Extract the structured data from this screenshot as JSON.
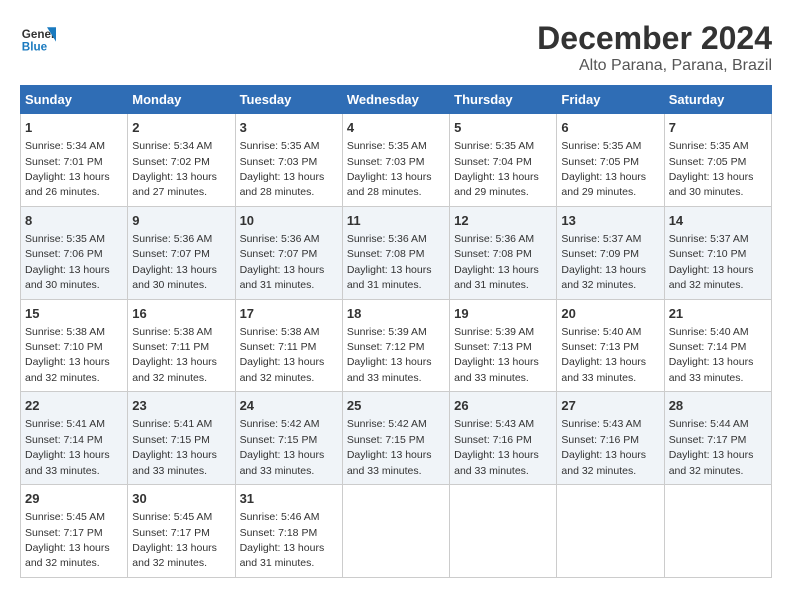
{
  "logo": {
    "general": "General",
    "blue": "Blue"
  },
  "title": "December 2024",
  "subtitle": "Alto Parana, Parana, Brazil",
  "days_header": [
    "Sunday",
    "Monday",
    "Tuesday",
    "Wednesday",
    "Thursday",
    "Friday",
    "Saturday"
  ],
  "weeks": [
    [
      {
        "day": "1",
        "info": "Sunrise: 5:34 AM\nSunset: 7:01 PM\nDaylight: 13 hours\nand 26 minutes."
      },
      {
        "day": "2",
        "info": "Sunrise: 5:34 AM\nSunset: 7:02 PM\nDaylight: 13 hours\nand 27 minutes."
      },
      {
        "day": "3",
        "info": "Sunrise: 5:35 AM\nSunset: 7:03 PM\nDaylight: 13 hours\nand 28 minutes."
      },
      {
        "day": "4",
        "info": "Sunrise: 5:35 AM\nSunset: 7:03 PM\nDaylight: 13 hours\nand 28 minutes."
      },
      {
        "day": "5",
        "info": "Sunrise: 5:35 AM\nSunset: 7:04 PM\nDaylight: 13 hours\nand 29 minutes."
      },
      {
        "day": "6",
        "info": "Sunrise: 5:35 AM\nSunset: 7:05 PM\nDaylight: 13 hours\nand 29 minutes."
      },
      {
        "day": "7",
        "info": "Sunrise: 5:35 AM\nSunset: 7:05 PM\nDaylight: 13 hours\nand 30 minutes."
      }
    ],
    [
      {
        "day": "8",
        "info": "Sunrise: 5:35 AM\nSunset: 7:06 PM\nDaylight: 13 hours\nand 30 minutes."
      },
      {
        "day": "9",
        "info": "Sunrise: 5:36 AM\nSunset: 7:07 PM\nDaylight: 13 hours\nand 30 minutes."
      },
      {
        "day": "10",
        "info": "Sunrise: 5:36 AM\nSunset: 7:07 PM\nDaylight: 13 hours\nand 31 minutes."
      },
      {
        "day": "11",
        "info": "Sunrise: 5:36 AM\nSunset: 7:08 PM\nDaylight: 13 hours\nand 31 minutes."
      },
      {
        "day": "12",
        "info": "Sunrise: 5:36 AM\nSunset: 7:08 PM\nDaylight: 13 hours\nand 31 minutes."
      },
      {
        "day": "13",
        "info": "Sunrise: 5:37 AM\nSunset: 7:09 PM\nDaylight: 13 hours\nand 32 minutes."
      },
      {
        "day": "14",
        "info": "Sunrise: 5:37 AM\nSunset: 7:10 PM\nDaylight: 13 hours\nand 32 minutes."
      }
    ],
    [
      {
        "day": "15",
        "info": "Sunrise: 5:38 AM\nSunset: 7:10 PM\nDaylight: 13 hours\nand 32 minutes."
      },
      {
        "day": "16",
        "info": "Sunrise: 5:38 AM\nSunset: 7:11 PM\nDaylight: 13 hours\nand 32 minutes."
      },
      {
        "day": "17",
        "info": "Sunrise: 5:38 AM\nSunset: 7:11 PM\nDaylight: 13 hours\nand 32 minutes."
      },
      {
        "day": "18",
        "info": "Sunrise: 5:39 AM\nSunset: 7:12 PM\nDaylight: 13 hours\nand 33 minutes."
      },
      {
        "day": "19",
        "info": "Sunrise: 5:39 AM\nSunset: 7:13 PM\nDaylight: 13 hours\nand 33 minutes."
      },
      {
        "day": "20",
        "info": "Sunrise: 5:40 AM\nSunset: 7:13 PM\nDaylight: 13 hours\nand 33 minutes."
      },
      {
        "day": "21",
        "info": "Sunrise: 5:40 AM\nSunset: 7:14 PM\nDaylight: 13 hours\nand 33 minutes."
      }
    ],
    [
      {
        "day": "22",
        "info": "Sunrise: 5:41 AM\nSunset: 7:14 PM\nDaylight: 13 hours\nand 33 minutes."
      },
      {
        "day": "23",
        "info": "Sunrise: 5:41 AM\nSunset: 7:15 PM\nDaylight: 13 hours\nand 33 minutes."
      },
      {
        "day": "24",
        "info": "Sunrise: 5:42 AM\nSunset: 7:15 PM\nDaylight: 13 hours\nand 33 minutes."
      },
      {
        "day": "25",
        "info": "Sunrise: 5:42 AM\nSunset: 7:15 PM\nDaylight: 13 hours\nand 33 minutes."
      },
      {
        "day": "26",
        "info": "Sunrise: 5:43 AM\nSunset: 7:16 PM\nDaylight: 13 hours\nand 33 minutes."
      },
      {
        "day": "27",
        "info": "Sunrise: 5:43 AM\nSunset: 7:16 PM\nDaylight: 13 hours\nand 32 minutes."
      },
      {
        "day": "28",
        "info": "Sunrise: 5:44 AM\nSunset: 7:17 PM\nDaylight: 13 hours\nand 32 minutes."
      }
    ],
    [
      {
        "day": "29",
        "info": "Sunrise: 5:45 AM\nSunset: 7:17 PM\nDaylight: 13 hours\nand 32 minutes."
      },
      {
        "day": "30",
        "info": "Sunrise: 5:45 AM\nSunset: 7:17 PM\nDaylight: 13 hours\nand 32 minutes."
      },
      {
        "day": "31",
        "info": "Sunrise: 5:46 AM\nSunset: 7:18 PM\nDaylight: 13 hours\nand 31 minutes."
      },
      null,
      null,
      null,
      null
    ]
  ]
}
